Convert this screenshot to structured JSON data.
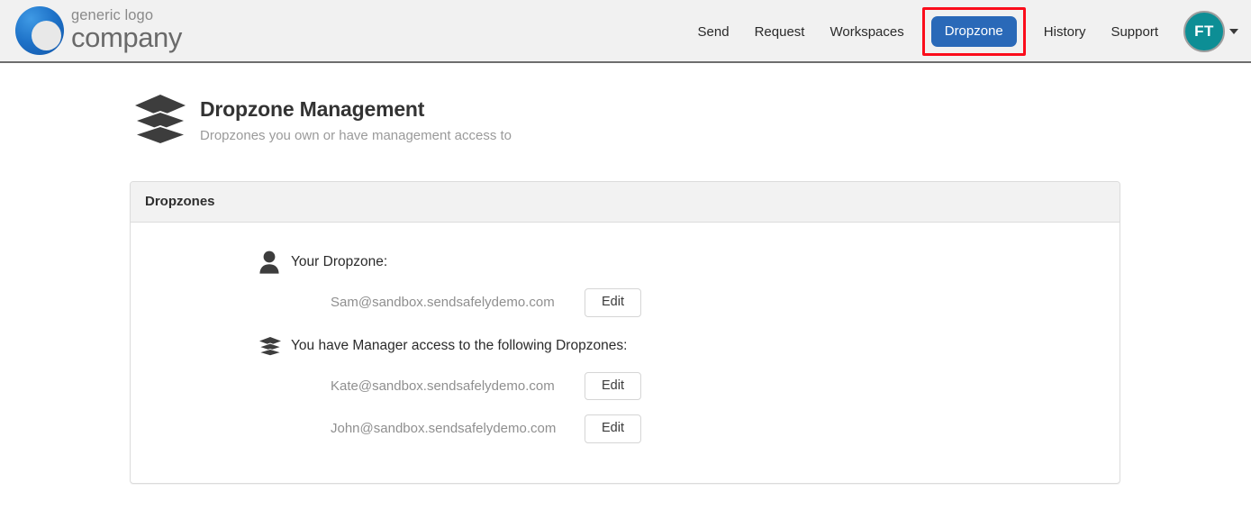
{
  "header": {
    "logo": {
      "mark_icon": "generic-circle-logo-icon",
      "line1": "generic logo",
      "line2": "company",
      "accent_color": "#1e72c8"
    },
    "nav": [
      {
        "label": "Send",
        "active": false
      },
      {
        "label": "Request",
        "active": false
      },
      {
        "label": "Workspaces",
        "active": false
      },
      {
        "label": "Dropzone",
        "active": true
      },
      {
        "label": "History",
        "active": false
      },
      {
        "label": "Support",
        "active": false
      }
    ],
    "active_nav_label": "Dropzone",
    "active_nav_bg": "#2a69b8",
    "highlight_box_color": "#fb0d1b",
    "account": {
      "initials": "FT",
      "avatar_color": "#0d8e95",
      "caret_icon": "chevron-down-icon"
    }
  },
  "page": {
    "icon": "layers-stack-icon",
    "title": "Dropzone Management",
    "subtitle": "Dropzones you own or have management access to"
  },
  "panel": {
    "title": "Dropzones",
    "groups": [
      {
        "icon": "person-icon",
        "label": "Your Dropzone:",
        "rows": [
          {
            "email": "Sam@sandbox.sendsafelydemo.com",
            "action": "Edit"
          }
        ]
      },
      {
        "icon": "layers-stack-icon",
        "label": "You have Manager access to the following Dropzones:",
        "rows": [
          {
            "email": "Kate@sandbox.sendsafelydemo.com",
            "action": "Edit"
          },
          {
            "email": "John@sandbox.sendsafelydemo.com",
            "action": "Edit"
          }
        ]
      }
    ]
  }
}
